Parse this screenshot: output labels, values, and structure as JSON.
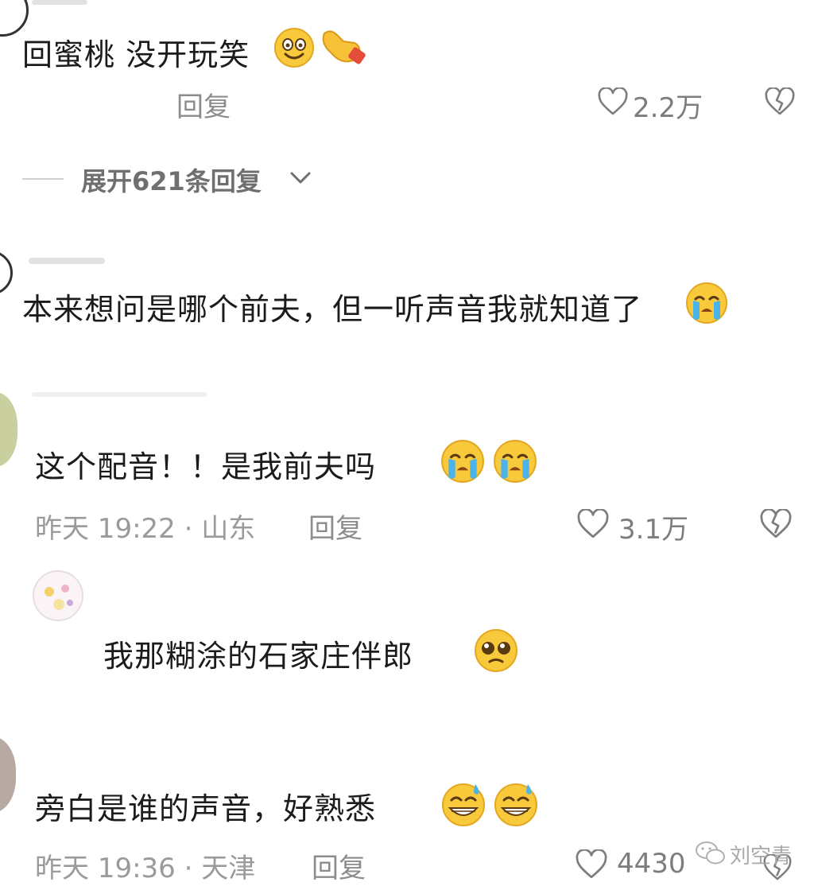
{
  "comments": [
    {
      "text": "回蜜桃 没开玩笑",
      "reply_label": "回复",
      "likes": "2.2万",
      "icons": [
        "grin-eyes-emoji",
        "pointing-hand-emoji"
      ]
    },
    {
      "text": "本来想问是哪个前夫，但一听声音我就知道了",
      "icons": [
        "crying-emoji"
      ]
    },
    {
      "text": "这个配音！！是我前夫吗",
      "meta": "昨天 19:22 · 山东",
      "reply_label": "回复",
      "likes": "3.1万",
      "icons": [
        "crying-emoji",
        "crying-emoji"
      ]
    },
    {
      "text": "我那糊涂的石家庄伴郎",
      "icons": [
        "pleading-emoji"
      ]
    },
    {
      "text": "旁白是谁的声音，好熟悉",
      "meta": "昨天 19:36 · 天津",
      "reply_label": "回复",
      "likes": "4430",
      "icons": [
        "sweat-grin-emoji",
        "sweat-grin-emoji"
      ]
    }
  ],
  "expand_replies": "展开621条回复",
  "watermark": "刘空青",
  "icons": {
    "like": "heart-outline-icon",
    "dislike": "broken-heart-icon",
    "expand": "chevron-down-icon",
    "watermark": "wechat-icon"
  }
}
